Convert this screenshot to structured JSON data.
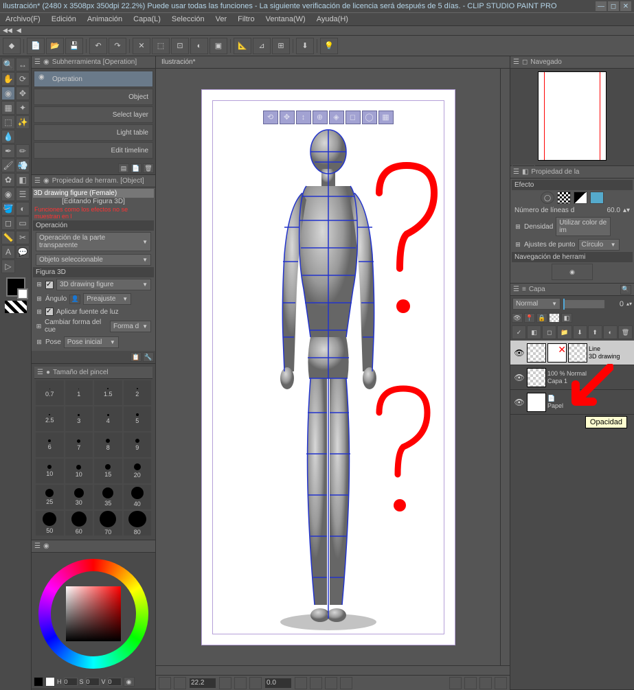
{
  "title": "Ilustración* (2480 x 3508px 350dpi 22.2%)  Puede usar todas las funciones - La siguiente verificación de licencia será después de 5 días. - CLIP STUDIO PAINT PRO",
  "menu": [
    "Archivo(F)",
    "Edición",
    "Animación",
    "Capa(L)",
    "Selección",
    "Ver",
    "Filtro",
    "Ventana(W)",
    "Ayuda(H)"
  ],
  "canvas_tab": "Ilustración*",
  "subtool": {
    "header": "Subherramienta [Operation]",
    "items": [
      "Operation",
      "Object",
      "Select layer",
      "Light table",
      "Edit timeline"
    ]
  },
  "toolprop": {
    "header": "Propiedad de herram. [Object]",
    "title1": "3D drawing figure (Female)",
    "title2": "[Editando Figura 3D]",
    "warning": "Funciones como los efectos no se muestran en l",
    "section_operacion": "Operación",
    "dd_transparente": "Operación de la parte transparente",
    "dd_seleccionable": "Objeto seleccionable",
    "section_figura": "Figura 3D",
    "figure_label": "3D drawing figure",
    "angulo": "Ángulo",
    "preajuste": "Preajuste",
    "luz": "Aplicar fuente de luz",
    "cambiar_forma": "Cambiar forma del cue",
    "forma_d": "Forma d",
    "pose": "Pose",
    "pose_inicial": "Pose inicial"
  },
  "brush": {
    "header": "Tamaño del pincel",
    "sizes": [
      "0.7",
      "1",
      "1.5",
      "2",
      "2.5",
      "3",
      "4",
      "5",
      "6",
      "7",
      "8",
      "9",
      "10",
      "10",
      "15",
      "20",
      "25",
      "30",
      "35",
      "40",
      "50",
      "60",
      "70",
      "80"
    ]
  },
  "hsv": {
    "h": "0",
    "s": "0",
    "v": "0"
  },
  "navigator": {
    "header": "Navegado",
    "zoom": "22.2",
    "rotation": "0.0"
  },
  "layer_prop": {
    "header": "Propiedad de la",
    "efecto": "Efecto",
    "lineas": "Número de líneas d",
    "lineas_val": "60.0",
    "densidad": "Densidad",
    "densidad_val": "Utilizar color de im",
    "ajustes": "Ajustes de punto",
    "ajustes_val": "Círculo",
    "nav_herr": "Navegación de herrami"
  },
  "layers": {
    "header": "Capa",
    "blend_mode": "Normal",
    "opacity": "0",
    "tooltip": "Opacidad",
    "list": [
      {
        "name": "Line",
        "sub": "3D drawing",
        "selected": true
      },
      {
        "name": "Capa 1",
        "top": "100 % Normal"
      },
      {
        "name": "Papel"
      }
    ]
  },
  "statusbar": {
    "zoom": "22.2",
    "rotation": "0.0"
  }
}
